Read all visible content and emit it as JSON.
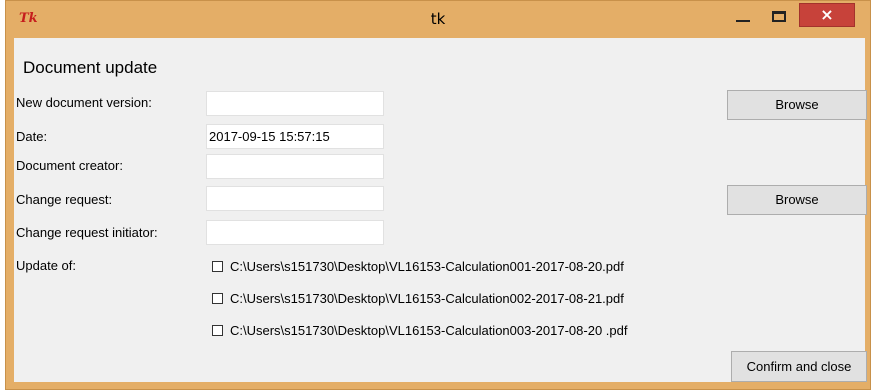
{
  "window": {
    "title": "tk",
    "close_glyph": "×",
    "logo_text": "Tk"
  },
  "form": {
    "heading": "Document update",
    "fields": [
      {
        "label": "New document version:",
        "value": ""
      },
      {
        "label": "Date:",
        "value": "2017-09-15 15:57:15"
      },
      {
        "label": "Document creator:",
        "value": ""
      },
      {
        "label": "Change request:",
        "value": ""
      },
      {
        "label": "Change request initiator:",
        "value": ""
      }
    ],
    "update_of_label": "Update of:",
    "update_files": [
      {
        "path": "C:\\Users\\s151730\\Desktop\\VL16153-Calculation001-2017-08-20.pdf",
        "checked": false
      },
      {
        "path": "C:\\Users\\s151730\\Desktop\\VL16153-Calculation002-2017-08-21.pdf",
        "checked": false
      },
      {
        "path": "C:\\Users\\s151730\\Desktop\\VL16153-Calculation003-2017-08-20 .pdf",
        "checked": false
      }
    ],
    "browse_version_label": "Browse",
    "browse_request_label": "Browse",
    "confirm_label": "Confirm and close"
  },
  "colors": {
    "titlebar": "#e4ae67",
    "close_button": "#c7423a",
    "form_background": "#f0f0f0"
  }
}
